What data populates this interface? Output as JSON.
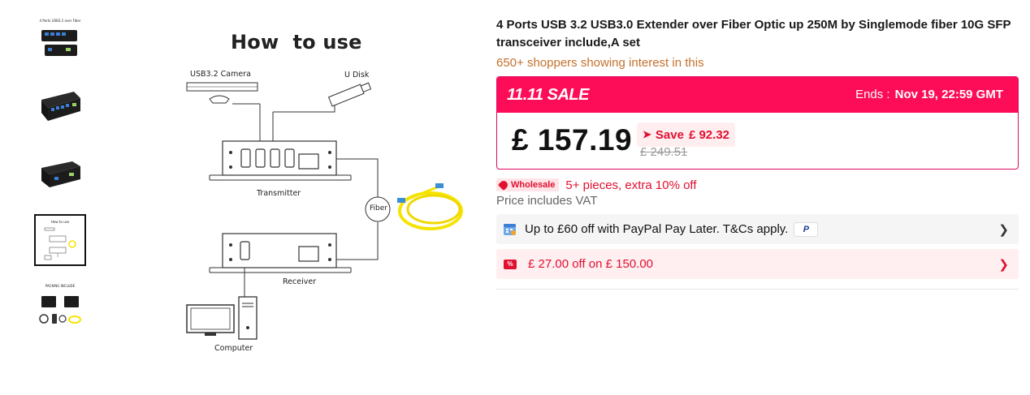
{
  "gallery": {
    "thumbnails": [
      {
        "name": "thumb-product-front",
        "caption": "4 Ports USB3.2 over Fiber",
        "active": false
      },
      {
        "name": "thumb-product-angle",
        "caption": "",
        "active": false
      },
      {
        "name": "thumb-product-side",
        "caption": "",
        "active": false
      },
      {
        "name": "thumb-how-to-use",
        "caption": "How to use",
        "active": true
      },
      {
        "name": "thumb-packing",
        "caption": "PACKING INCLUDE",
        "active": false
      }
    ],
    "main_image": {
      "title": "How  to use",
      "labels": {
        "camera": "USB3.2 Camera",
        "udisk": "U Disk",
        "transmitter": "Transmitter",
        "fiber": "Fiber",
        "receiver": "Receiver",
        "computer": "Computer"
      }
    }
  },
  "product": {
    "title": "4 Ports USB 3.2 USB3.0 Extender over Fiber Optic up 250M by Singlemode fiber 10G SFP transceiver include,A set",
    "interest": "650+ shoppers showing interest in this"
  },
  "sale": {
    "logo": "11.11 SALE",
    "ends_label": "Ends :",
    "ends_value": "Nov 19, 22:59 GMT",
    "price": "£ 157.19",
    "save_label": "Save",
    "save_amount": "£ 92.32",
    "original_price": "£ 249.51"
  },
  "wholesale": {
    "badge": "Wholesale",
    "text": "5+ pieces, extra 10% off"
  },
  "vat": "Price includes VAT",
  "paypal": {
    "text": "Up to £60 off with PayPal Pay Later. T&Cs apply.",
    "logo": "P"
  },
  "coupon": {
    "icon": "%",
    "text": "£ 27.00 off on  £ 150.00"
  },
  "colors": {
    "accent": "#fd0c57",
    "sale_red": "#e01030",
    "interest_orange": "#c4702b",
    "cable_yellow": "#f5e400"
  },
  "icons": {
    "save": "arrow-down-icon",
    "wholesale": "tag-icon",
    "paypal_row": "calendar-icon",
    "paypal_logo": "paypal-icon",
    "coupon": "coupon-icon",
    "chevrons": "chevron-right-icon"
  }
}
